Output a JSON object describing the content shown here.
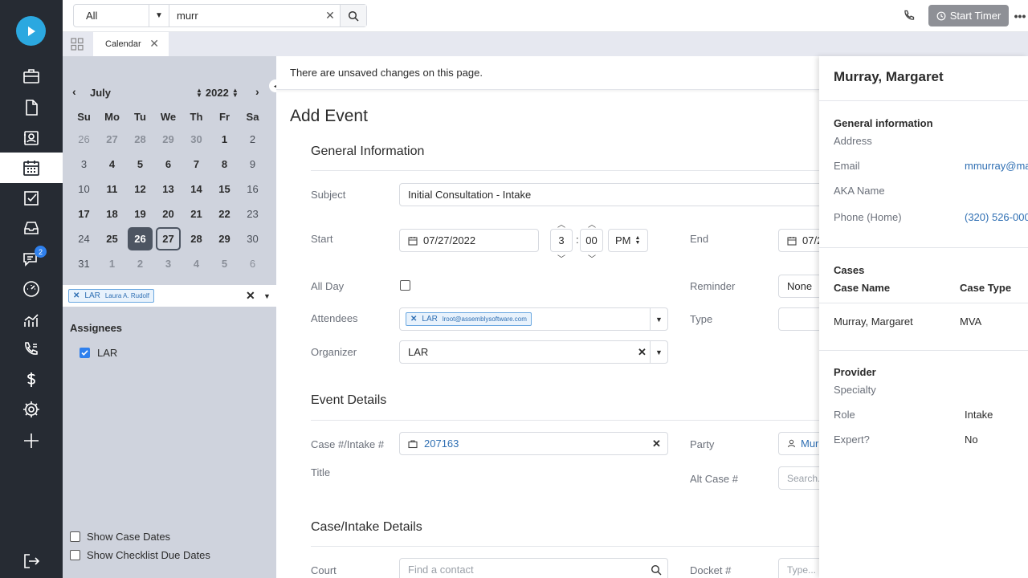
{
  "topbar": {
    "scope": "All",
    "search_value": "murr",
    "start_timer": "Start Timer"
  },
  "nav": {
    "messages_badge": "2"
  },
  "tabs": [
    {
      "label": "Calendar"
    }
  ],
  "calendar": {
    "month": "July",
    "year": "2022",
    "weekdays": [
      "Su",
      "Mo",
      "Tu",
      "We",
      "Th",
      "Fr",
      "Sa"
    ],
    "weeks": [
      [
        "26",
        "27",
        "28",
        "29",
        "30",
        "1",
        "2"
      ],
      [
        "3",
        "4",
        "5",
        "6",
        "7",
        "8",
        "9"
      ],
      [
        "10",
        "11",
        "12",
        "13",
        "14",
        "15",
        "16"
      ],
      [
        "17",
        "18",
        "19",
        "20",
        "21",
        "22",
        "23"
      ],
      [
        "24",
        "25",
        "26",
        "27",
        "28",
        "29",
        "30"
      ],
      [
        "31",
        "1",
        "2",
        "3",
        "4",
        "5",
        "6"
      ]
    ],
    "selected_day": "26",
    "today": "27"
  },
  "filter": {
    "chip_code": "LAR",
    "chip_name": "Laura A. Rudolf"
  },
  "assignees": {
    "title": "Assignees",
    "items": [
      {
        "label": "LAR",
        "checked": true
      }
    ]
  },
  "options": {
    "show_case_dates": "Show Case Dates",
    "show_checklist": "Show Checklist Due Dates"
  },
  "form": {
    "unsaved_notice": "There are unsaved changes on this page.",
    "title": "Add Event",
    "general_info": {
      "heading": "General Information",
      "subject_label": "Subject",
      "subject_value": "Initial Consultation - Intake",
      "start_label": "Start",
      "start_date": "07/27/2022",
      "start_hour": "3",
      "start_minute": "00",
      "start_ampm": "PM",
      "end_label": "End",
      "end_date": "07/2",
      "allday_label": "All Day",
      "reminder_label": "Reminder",
      "reminder_value": "None",
      "attendees_label": "Attendees",
      "attendee_code": "LAR",
      "attendee_email": "lroot@assemblysoftware.com",
      "type_label": "Type",
      "organizer_label": "Organizer",
      "organizer_value": "LAR"
    },
    "event_details": {
      "heading": "Event Details",
      "case_label": "Case #/Intake #",
      "case_value": "207163",
      "party_label": "Party",
      "party_value": "Mur",
      "title_label": "Title",
      "alt_case_label": "Alt Case #",
      "alt_case_placeholder": "Search..."
    },
    "case_details": {
      "heading": "Case/Intake Details",
      "court_label": "Court",
      "court_placeholder": "Find a contact",
      "docket_label": "Docket #",
      "docket_placeholder": "Type..."
    }
  },
  "panel": {
    "name": "Murray, Margaret",
    "general_heading": "General information",
    "address_label": "Address",
    "email_label": "Email",
    "email_value": "mmurray@ma",
    "aka_label": "AKA Name",
    "phone_label": "Phone (Home)",
    "phone_value": "(320) 526-000",
    "cases_heading": "Cases",
    "case_name_col": "Case Name",
    "case_type_col": "Case Type",
    "case_name": "Murray, Margaret",
    "case_type": "MVA",
    "provider_heading": "Provider",
    "specialty_label": "Specialty",
    "role_label": "Role",
    "role_value": "Intake",
    "expert_label": "Expert?",
    "expert_value": "No"
  },
  "colors": {
    "nav_bg": "#262b33",
    "accent": "#2ba8e0",
    "link": "#2f6fb3",
    "calendar_pane": "#cfd3dd"
  }
}
